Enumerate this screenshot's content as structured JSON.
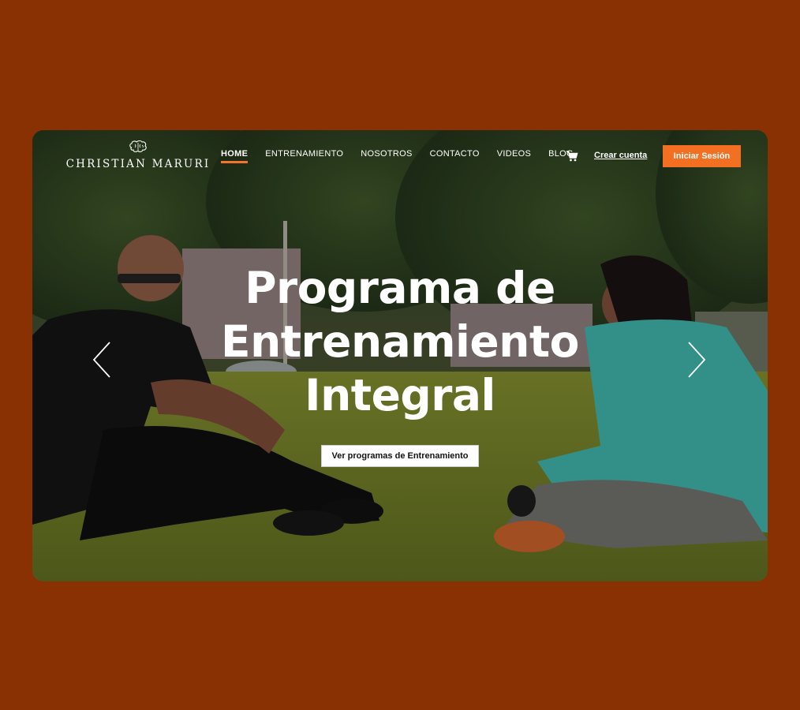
{
  "brand": {
    "name": "CHRISTIAN MARURI",
    "logo_icon": "brain-icon"
  },
  "nav": {
    "items": [
      {
        "label": "HOME",
        "active": true
      },
      {
        "label": "ENTRENAMIENTO",
        "active": false
      },
      {
        "label": "NOSOTROS",
        "active": false
      },
      {
        "label": "CONTACTO",
        "active": false
      },
      {
        "label": "VIDEOS",
        "active": false
      },
      {
        "label": "BLOG",
        "active": false
      }
    ],
    "cart_icon": "cart-icon",
    "create_account_label": "Crear cuenta",
    "login_label": "Iniciar Sesión"
  },
  "hero": {
    "title_lines": [
      "Programa de",
      "Entrenamiento",
      "Integral"
    ],
    "cta_label": "Ver programas de Entrenamiento",
    "prev_icon": "chevron-left-icon",
    "next_icon": "chevron-right-icon"
  },
  "colors": {
    "page_background": "#8a3104",
    "accent": "#f36f21"
  }
}
